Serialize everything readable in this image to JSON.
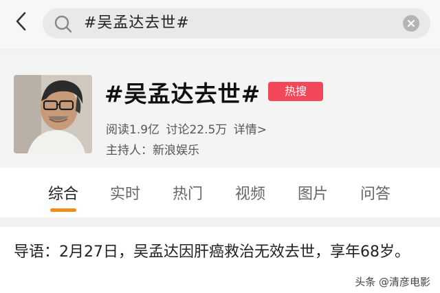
{
  "search": {
    "query": "#吴孟达去世#"
  },
  "topic": {
    "title": "#吴孟达去世#",
    "badge": "热搜",
    "reads": "阅读1.9亿",
    "discussions": "讨论22.5万",
    "detail_link": "详情>",
    "host": "主持人：新浪娱乐"
  },
  "tabs": [
    {
      "label": "综合"
    },
    {
      "label": "实时"
    },
    {
      "label": "热门"
    },
    {
      "label": "视频"
    },
    {
      "label": "图片"
    },
    {
      "label": "问答"
    }
  ],
  "intro": {
    "text": "导语：2月27日，吴孟达因肝癌救治无效去世，享年68岁。"
  },
  "watermark": "头条 @清彦电影",
  "colors": {
    "accent": "#f08c17",
    "badge": "#f2485a"
  }
}
